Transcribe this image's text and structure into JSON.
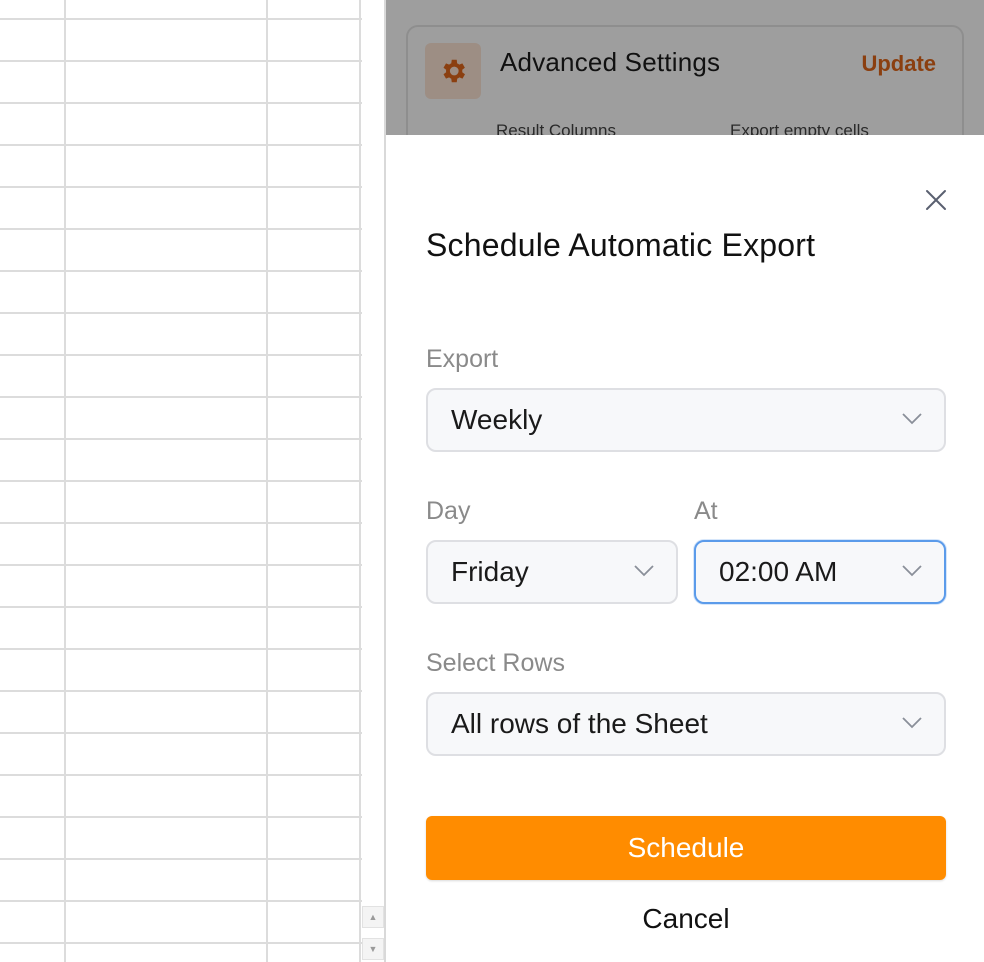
{
  "background": {
    "title": "Advanced Settings",
    "update_label": "Update",
    "icon": "gear-icon",
    "col_result": "Result Columns",
    "col_export_empty": "Export empty cells"
  },
  "modal": {
    "title": "Schedule Automatic Export",
    "close_icon": "close-icon",
    "export": {
      "label": "Export",
      "value": "Weekly"
    },
    "day": {
      "label": "Day",
      "value": "Friday"
    },
    "at": {
      "label": "At",
      "value": "02:00 AM"
    },
    "rows": {
      "label": "Select Rows",
      "value": "All rows of the Sheet"
    },
    "schedule_label": "Schedule",
    "cancel_label": "Cancel"
  },
  "scrollbar": {
    "up_icon": "▲",
    "down_icon": "▼"
  },
  "colors": {
    "accent": "#ff8c00",
    "update_text": "#e0671a",
    "focus_border": "#5b9bea"
  }
}
